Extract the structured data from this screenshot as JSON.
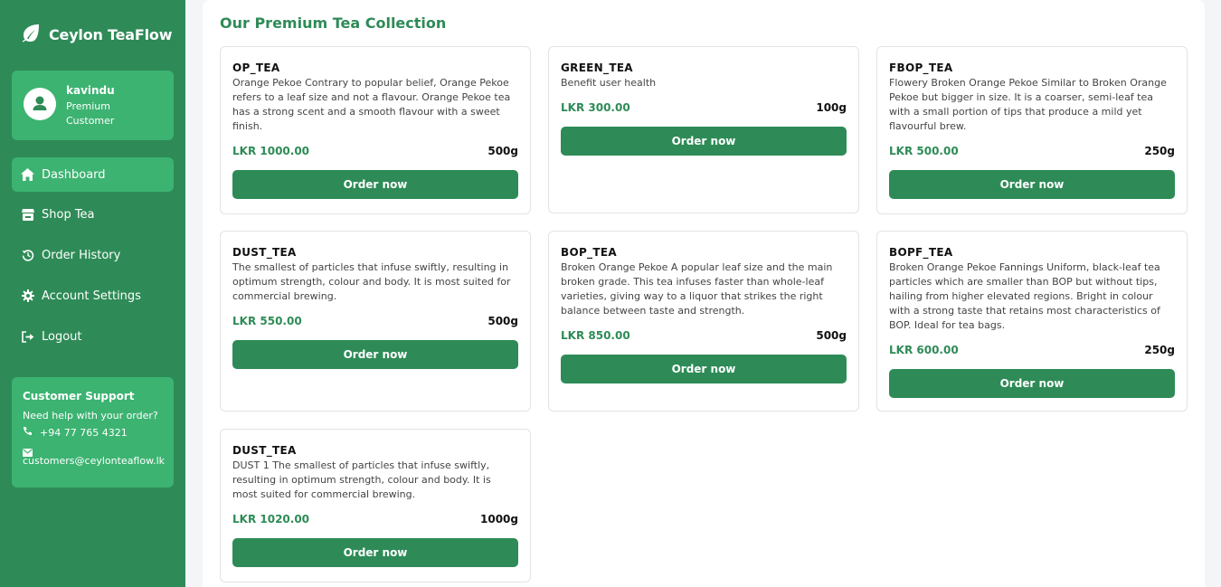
{
  "brand": {
    "name": "Ceylon TeaFlow"
  },
  "user": {
    "name": "kavindu",
    "role": "Premium Customer"
  },
  "nav": [
    {
      "label": "Dashboard",
      "icon": "home-icon"
    },
    {
      "label": "Shop Tea",
      "icon": "store-icon"
    },
    {
      "label": "Order History",
      "icon": "history-icon"
    },
    {
      "label": "Account Settings",
      "icon": "gear-icon"
    },
    {
      "label": "Logout",
      "icon": "logout-icon"
    }
  ],
  "support": {
    "title": "Customer Support",
    "text": "Need help with your order?",
    "phone": "+94 77 765 4321",
    "email": "customers@ceylonteaflow.lk"
  },
  "main": {
    "title": "Our Premium Tea Collection"
  },
  "products": [
    {
      "name": "OP_TEA",
      "description": "Orange Pekoe Contrary to popular belief, Orange Pekoe refers to a leaf size and not a flavour. Orange Pekoe tea has a strong scent and a smooth flavour with a sweet finish.",
      "price": "LKR 1000.00",
      "weight": "500g",
      "button": "Order now"
    },
    {
      "name": "GREEN_TEA",
      "description": "Benefit user health",
      "price": "LKR 300.00",
      "weight": "100g",
      "button": "Order now"
    },
    {
      "name": "FBOP_TEA",
      "description": "Flowery Broken Orange Pekoe Similar to Broken Orange Pekoe but bigger in size. It is a coarser, semi-leaf tea with a small portion of tips that produce a mild yet flavourful brew.",
      "price": "LKR 500.00",
      "weight": "250g",
      "button": "Order now"
    },
    {
      "name": "DUST_TEA",
      "description": "The smallest of particles that infuse swiftly, resulting in optimum strength, colour and body. It is most suited for commercial brewing.",
      "price": "LKR 550.00",
      "weight": "500g",
      "button": "Order now"
    },
    {
      "name": "BOP_TEA",
      "description": "Broken Orange Pekoe A popular leaf size and the main broken grade. This tea infuses faster than whole-leaf varieties, giving way to a liquor that strikes the right balance between taste and strength.",
      "price": "LKR 850.00",
      "weight": "500g",
      "button": "Order now"
    },
    {
      "name": "BOPF_TEA",
      "description": "Broken Orange Pekoe Fannings Uniform, black-leaf tea particles which are smaller than BOP but without tips, hailing from higher elevated regions. Bright in colour with a strong taste that retains most characteristics of BOP. Ideal for tea bags.",
      "price": "LKR 600.00",
      "weight": "250g",
      "button": "Order now"
    },
    {
      "name": "DUST_TEA",
      "description": "DUST 1 The smallest of particles that infuse swiftly, resulting in optimum strength, colour and body. It is most suited for commercial brewing.",
      "price": "LKR 1020.00",
      "weight": "1000g",
      "button": "Order now"
    }
  ],
  "colors": {
    "primary": "#2e8b57",
    "accent": "#3cb371",
    "background": "#f4f5f7"
  }
}
